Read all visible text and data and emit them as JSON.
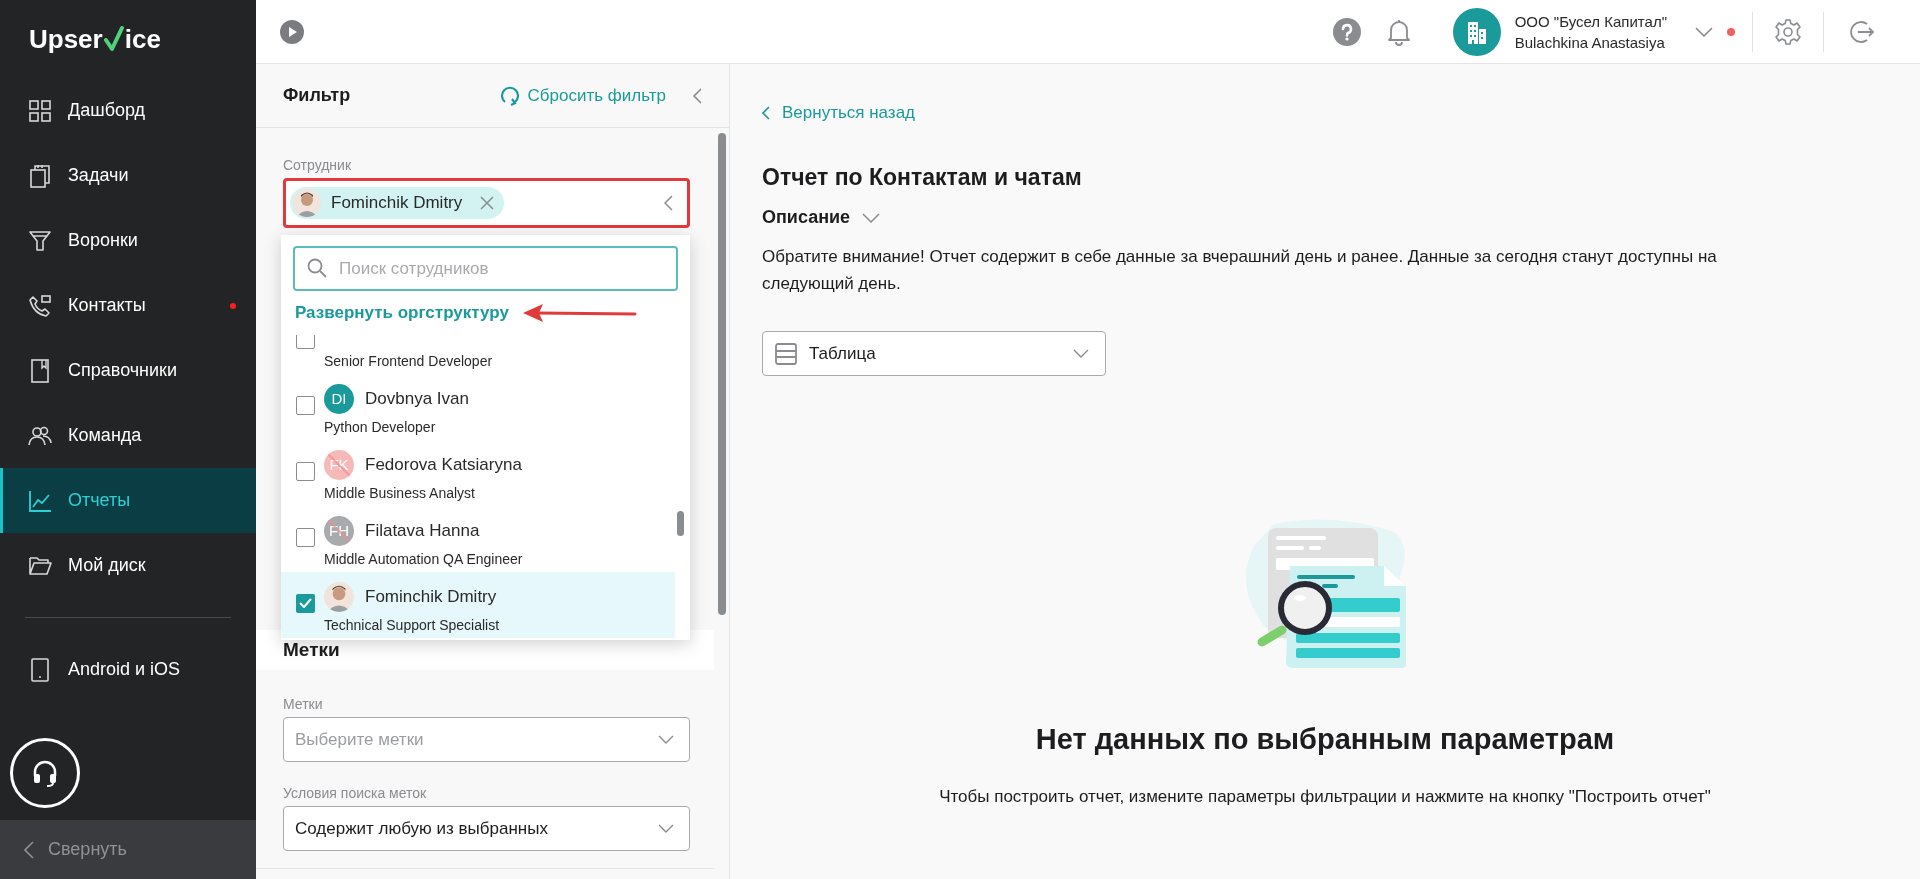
{
  "logo": {
    "before": "Upser",
    "after": "ice"
  },
  "sidebar": {
    "items": [
      {
        "kind": "grid",
        "label": "Дашборд",
        "selected": false,
        "dot": false
      },
      {
        "kind": "clipboard",
        "label": "Задачи",
        "selected": false,
        "dot": false
      },
      {
        "kind": "funnel",
        "label": "Воронки",
        "selected": false,
        "dot": false
      },
      {
        "kind": "phone",
        "label": "Контакты",
        "selected": false,
        "dot": true
      },
      {
        "kind": "book",
        "label": "Справочники",
        "selected": false,
        "dot": false
      },
      {
        "kind": "people",
        "label": "Команда",
        "selected": false,
        "dot": false
      },
      {
        "kind": "chart",
        "label": "Отчеты",
        "selected": true,
        "dot": false
      },
      {
        "kind": "folder",
        "label": "Мой диск",
        "selected": false,
        "dot": false
      }
    ],
    "extra_items": [
      {
        "kind": "tablet",
        "label": "Android и iOS",
        "selected": false,
        "dot": false
      }
    ],
    "collapse": "Свернуть"
  },
  "header": {
    "company": "ООО \"Бусел Капитал\"",
    "user": "Bulachkina Anastasiya",
    "notification_dot": true
  },
  "filter": {
    "title": "Фильтр",
    "reset": "Сбросить фильтр",
    "employee": {
      "label": "Сотрудник",
      "chip": "Fominchik Dmitry",
      "search_placeholder": "Поиск сотрудников",
      "expand_link": "Развернуть оргструктуру",
      "options": [
        {
          "role": "Senior Frontend Developer",
          "checked": false
        },
        {
          "kind": "initials",
          "name": "Dovbnya Ivan",
          "role": "Python Developer",
          "checked": false,
          "initials": "DI"
        },
        {
          "kind": "blocked_pink",
          "name": "Fedorova Katsiaryna",
          "role": "Middle Business Analyst",
          "checked": false,
          "initials": "FK"
        },
        {
          "kind": "blocked_gray",
          "name": "Filatava Hanna",
          "role": "Middle Automation QA Engineer",
          "checked": false,
          "initials": "FH"
        },
        {
          "kind": "photo",
          "name": "Fominchik Dmitry",
          "role": "Technical Support Specialist",
          "checked": true
        }
      ]
    },
    "tags_section": "Метки",
    "tags": {
      "label": "Метки",
      "placeholder": "Выберите метки"
    },
    "tag_condition": {
      "label": "Условия поиска меток",
      "value": "Содержит любую из выбранных"
    }
  },
  "report": {
    "back": "Вернуться назад",
    "title": "Отчет по Контактам и чатам",
    "description_toggle": "Описание",
    "description": "Обратите внимание! Отчет содержит в себе данные за вчерашний день и ранее. Данные за сегодня станут доступны на следующий день.",
    "view": "Таблица",
    "empty_title": "Нет данных по выбранным параметрам",
    "empty_text": "Чтобы построить отчет, измените параметры фильтрации и нажмите на кнопку \"Построить отчет\""
  }
}
